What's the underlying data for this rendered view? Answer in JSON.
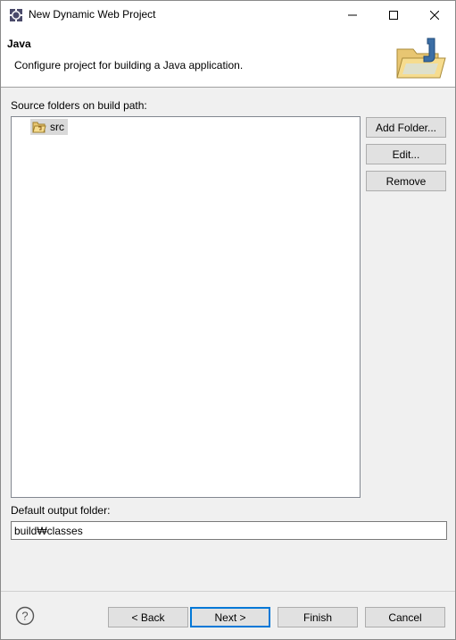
{
  "window": {
    "title": "New Dynamic Web Project",
    "icons": {
      "app": "eclipse-gear-icon",
      "minimize": "minimize-icon",
      "maximize": "maximize-icon",
      "close": "close-icon"
    }
  },
  "header": {
    "title": "Java",
    "description": "Configure project for building a Java application.",
    "banner_icon": "java-folder-wizard-icon"
  },
  "source": {
    "label": "Source folders on build path:",
    "items": [
      {
        "label": "src",
        "icon": "source-folder-icon"
      }
    ]
  },
  "side_buttons": {
    "add_folder": "Add Folder...",
    "edit": "Edit...",
    "remove": "Remove"
  },
  "output": {
    "label": "Default output folder:",
    "value": "build₩classes"
  },
  "footer": {
    "help_icon": "help-icon",
    "back": "< Back",
    "next": "Next >",
    "finish": "Finish",
    "cancel": "Cancel"
  },
  "colors": {
    "focus_border": "#0078d7",
    "button_face": "#e1e1e1",
    "dialog_bg": "#f0f0f0"
  }
}
